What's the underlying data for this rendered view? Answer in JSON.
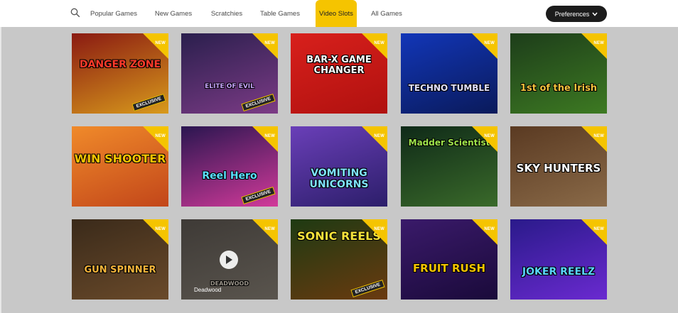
{
  "nav": {
    "tabs": [
      {
        "label": "Popular Games",
        "active": false
      },
      {
        "label": "New Games",
        "active": false
      },
      {
        "label": "Scratchies",
        "active": false
      },
      {
        "label": "Table Games",
        "active": false
      },
      {
        "label": "Video Slots",
        "active": true
      },
      {
        "label": "All Games",
        "active": false
      }
    ],
    "preferences_label": "Preferences",
    "accent_color": "#f5c400"
  },
  "games": [
    {
      "title": "DANGER ZONE",
      "badge": "NEW",
      "exclusive": "EXCLUSIVE",
      "colors": [
        "#8a1a12",
        "#d89a1c"
      ],
      "title_color": "#ff3a2a"
    },
    {
      "title": "ELITE OF EVIL",
      "badge": "NEW",
      "exclusive": "EXCLUSIVE",
      "colors": [
        "#2a1f4d",
        "#7c3b86"
      ],
      "title_color": "#c9a6ff"
    },
    {
      "title": "BAR-X GAME CHANGER",
      "badge": "NEW",
      "exclusive": "",
      "colors": [
        "#d8201c",
        "#b0110f"
      ],
      "title_color": "#ffffff"
    },
    {
      "title": "TECHNO TUMBLE",
      "badge": "NEW",
      "exclusive": "",
      "colors": [
        "#1236b8",
        "#0a1a5a"
      ],
      "title_color": "#e0e0ff"
    },
    {
      "title": "1st of the Irish",
      "badge": "NEW",
      "exclusive": "",
      "colors": [
        "#1d3d1a",
        "#3d7a22"
      ],
      "title_color": "#f2c23c"
    },
    {
      "title": "WIN SHOOTER",
      "badge": "NEW",
      "exclusive": "",
      "colors": [
        "#f08a2a",
        "#c2461a"
      ],
      "title_color": "#f5c400"
    },
    {
      "title": "Reel Hero",
      "badge": "NEW",
      "exclusive": "EXCLUSIVE",
      "colors": [
        "#2a1650",
        "#d23a9a"
      ],
      "title_color": "#5ae0ff"
    },
    {
      "title": "VOMITING UNICORNS",
      "badge": "NEW",
      "exclusive": "",
      "colors": [
        "#6a3fb8",
        "#2c1e6a"
      ],
      "title_color": "#7fe3ff"
    },
    {
      "title": "Madder Scientist",
      "badge": "NEW",
      "exclusive": "",
      "colors": [
        "#0f2a18",
        "#3a6a2a"
      ],
      "title_color": "#9ee34a"
    },
    {
      "title": "SKY HUNTERS",
      "badge": "NEW",
      "exclusive": "",
      "colors": [
        "#5a3a22",
        "#8a6a48"
      ],
      "title_color": "#ffffff"
    },
    {
      "title": "GUN SPINNER",
      "badge": "NEW",
      "exclusive": "",
      "colors": [
        "#3a2a1a",
        "#6a4a2a"
      ],
      "title_color": "#f5b43a"
    },
    {
      "title": "DEADWOOD",
      "badge": "NEW",
      "exclusive": "",
      "caption": "Deadwood",
      "colors": [
        "#3e3a36",
        "#5a554e"
      ],
      "title_color": "#9a948a"
    },
    {
      "title": "SONIC REELS",
      "badge": "NEW",
      "exclusive": "EXCLUSIVE",
      "colors": [
        "#1e3a12",
        "#6a3a10"
      ],
      "title_color": "#f5e23a"
    },
    {
      "title": "FRUIT RUSH",
      "badge": "NEW",
      "exclusive": "",
      "colors": [
        "#3a1a6a",
        "#1a0a3a"
      ],
      "title_color": "#f5c400"
    },
    {
      "title": "JOKER REELZ",
      "badge": "NEW",
      "exclusive": "",
      "colors": [
        "#2a1a8a",
        "#6a2ad0"
      ],
      "title_color": "#5ad6ff"
    }
  ]
}
